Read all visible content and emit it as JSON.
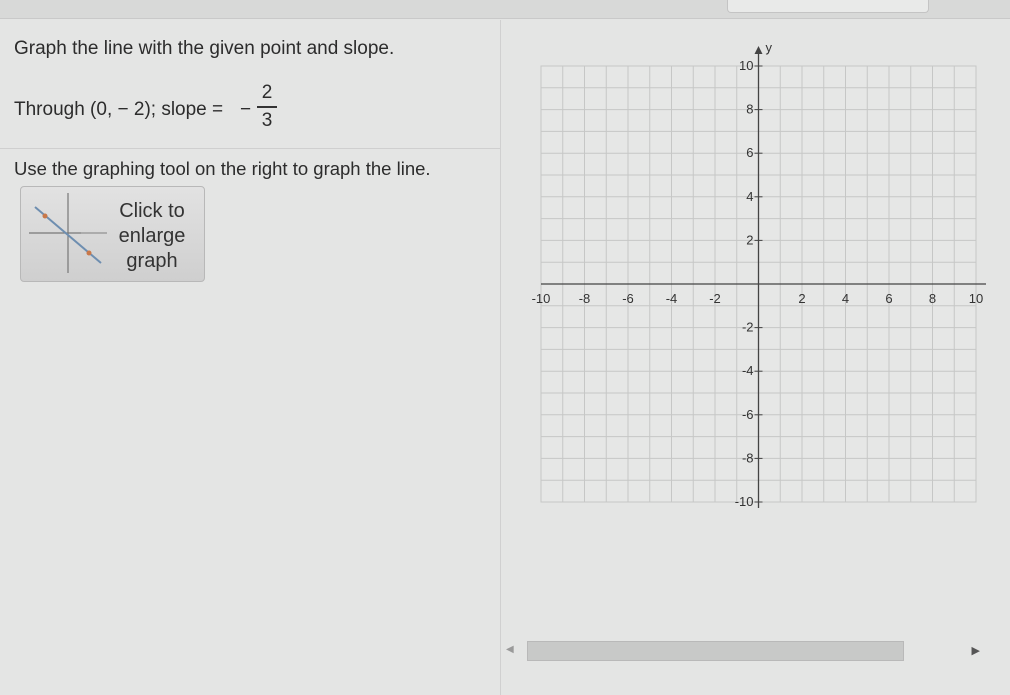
{
  "problem": {
    "title": "Graph the line with the given point and slope.",
    "through_text": "Through (0, − 2); slope =",
    "slope_sign": "−",
    "slope_numerator": "2",
    "slope_denominator": "3",
    "instruction": "Use the graphing tool on the right to graph the line."
  },
  "enlarge_button": {
    "line1": "Click to",
    "line2": "enlarge",
    "line3": "graph",
    "thumbnail_icon": "graph-thumbnail-icon"
  },
  "graph": {
    "y_axis_label": "y",
    "x_ticks": [
      "-10",
      "-8",
      "-6",
      "-4",
      "-2",
      "2",
      "4",
      "6",
      "8",
      "10"
    ],
    "y_ticks": [
      "10",
      "8",
      "6",
      "4",
      "2",
      "-2",
      "-4",
      "-6",
      "-8",
      "-10"
    ],
    "x_range": [
      -10,
      10
    ],
    "y_range": [
      -10,
      10
    ],
    "grid": true,
    "colors": {
      "grid": "#c6c7c6",
      "axis": "#444444",
      "background": "#e6e7e6"
    }
  },
  "scrollbar": {
    "left_arrow": "◀",
    "right_arrow": "▶"
  }
}
